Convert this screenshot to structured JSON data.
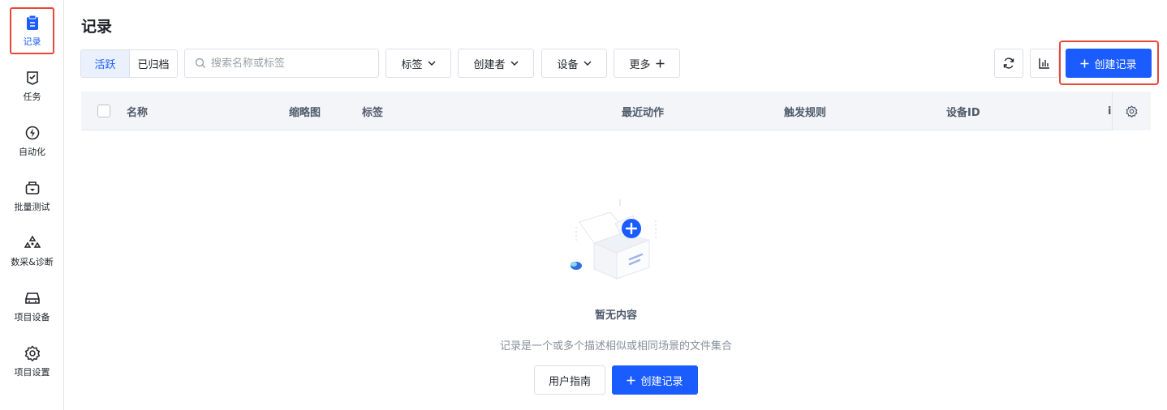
{
  "sidebar": {
    "items": [
      {
        "label": "记录",
        "icon": "record-icon",
        "active": true
      },
      {
        "label": "任务",
        "icon": "task-icon"
      },
      {
        "label": "自动化",
        "icon": "automation-icon"
      },
      {
        "label": "批量测试",
        "icon": "batch-test-icon"
      },
      {
        "label": "数采&诊断",
        "icon": "diagnosis-icon"
      },
      {
        "label": "项目设备",
        "icon": "device-icon"
      },
      {
        "label": "项目设置",
        "icon": "settings-icon"
      }
    ]
  },
  "page": {
    "title": "记录"
  },
  "toolbar": {
    "tabs": {
      "active": "活跃",
      "archived": "已归档"
    },
    "search_placeholder": "搜索名称或标签",
    "filters": {
      "tags": "标签",
      "creator": "创建者",
      "device": "设备",
      "more": "更多"
    },
    "create_label": "创建记录"
  },
  "table": {
    "columns": [
      "名称",
      "缩略图",
      "标签",
      "最近动作",
      "触发规则",
      "设备ID",
      "i"
    ]
  },
  "empty": {
    "title": "暂无内容",
    "description": "记录是一个或多个描述相似或相同场景的文件集合",
    "guide_label": "用户指南",
    "create_label": "创建记录"
  },
  "colors": {
    "accent": "#1a5cff",
    "highlight": "#e8473a"
  }
}
